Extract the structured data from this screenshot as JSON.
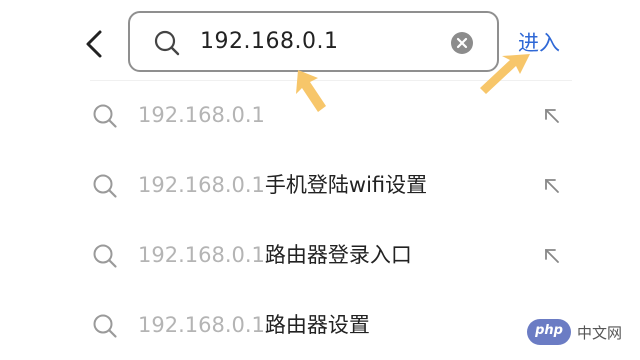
{
  "search": {
    "query": "192.168.0.1",
    "enter_label": "进入"
  },
  "suggestions": [
    {
      "prefix": "192.168.0.1",
      "suffix": ""
    },
    {
      "prefix": "192.168.0.1",
      "suffix": "手机登陆wifi设置"
    },
    {
      "prefix": "192.168.0.1",
      "suffix": "路由器登录入口"
    },
    {
      "prefix": "192.168.0.1",
      "suffix": "路由器设置"
    }
  ],
  "watermark": {
    "logo": "php",
    "text": "中文网"
  },
  "colors": {
    "accent": "#2f68d6",
    "annotation_arrow": "#f7c66a",
    "suggestion_gray": "#b4b4b4"
  },
  "icons": [
    "back-icon",
    "search-icon",
    "clear-icon",
    "fill-arrow-icon"
  ]
}
